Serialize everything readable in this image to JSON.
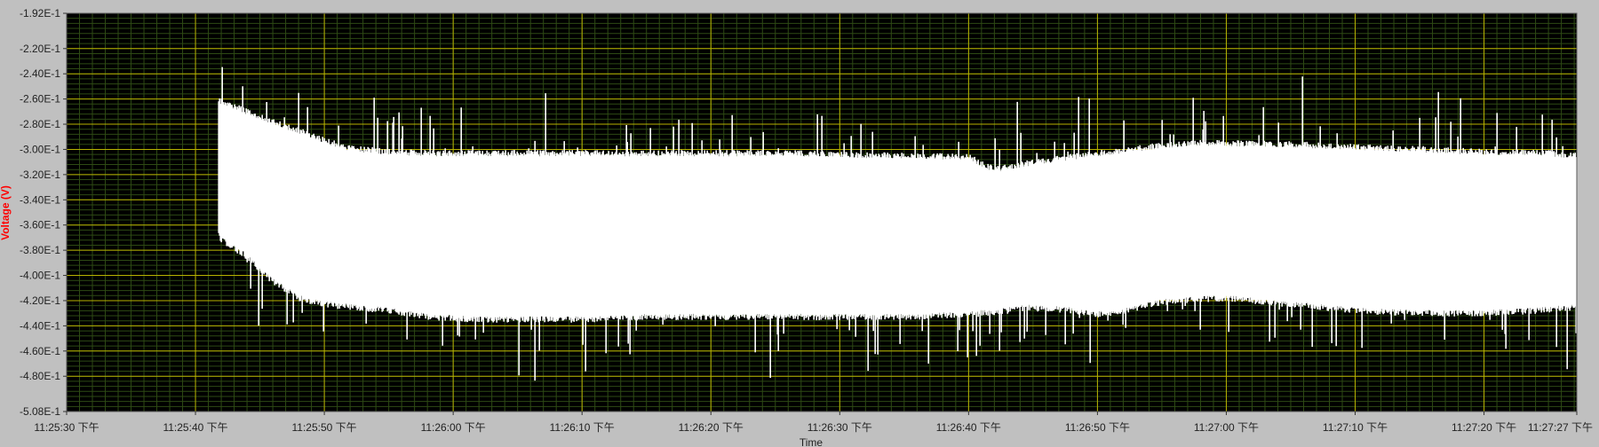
{
  "chart_data": {
    "type": "area",
    "xlabel": "Time",
    "ylabel": "Voltage (V)",
    "x_ticks": [
      {
        "t": 0,
        "label": "11:25:30 下午"
      },
      {
        "t": 10,
        "label": "11:25:40 下午"
      },
      {
        "t": 20,
        "label": "11:25:50 下午"
      },
      {
        "t": 30,
        "label": "11:26:00 下午"
      },
      {
        "t": 40,
        "label": "11:26:10 下午"
      },
      {
        "t": 50,
        "label": "11:26:20 下午"
      },
      {
        "t": 60,
        "label": "11:26:30 下午"
      },
      {
        "t": 70,
        "label": "11:26:40 下午"
      },
      {
        "t": 80,
        "label": "11:26:50 下午"
      },
      {
        "t": 90,
        "label": "11:27:00 下午"
      },
      {
        "t": 100,
        "label": "11:27:10 下午"
      },
      {
        "t": 110,
        "label": "11:27:20 下午"
      },
      {
        "t": 117.2,
        "label": "11:27:27 下午"
      }
    ],
    "y_ticks": [
      {
        "v": -0.192,
        "label": "-1.92E-1"
      },
      {
        "v": -0.22,
        "label": "-2.20E-1"
      },
      {
        "v": -0.24,
        "label": "-2.40E-1"
      },
      {
        "v": -0.26,
        "label": "-2.60E-1"
      },
      {
        "v": -0.28,
        "label": "-2.80E-1"
      },
      {
        "v": -0.3,
        "label": "-3.00E-1"
      },
      {
        "v": -0.32,
        "label": "-3.20E-1"
      },
      {
        "v": -0.34,
        "label": "-3.40E-1"
      },
      {
        "v": -0.36,
        "label": "-3.60E-1"
      },
      {
        "v": -0.38,
        "label": "-3.80E-1"
      },
      {
        "v": -0.4,
        "label": "-4.00E-1"
      },
      {
        "v": -0.42,
        "label": "-4.20E-1"
      },
      {
        "v": -0.44,
        "label": "-4.40E-1"
      },
      {
        "v": -0.46,
        "label": "-4.60E-1"
      },
      {
        "v": -0.48,
        "label": "-4.80E-1"
      },
      {
        "v": -0.508,
        "label": "-5.08E-1"
      }
    ],
    "xlim": [
      0,
      117.2
    ],
    "ylim": [
      -0.508,
      -0.192
    ],
    "grid": true,
    "colors": {
      "plot_bg": "#000000",
      "major_grid": "#b8b200",
      "minor_grid": "#2e4a14",
      "trace": "#ffffff",
      "frame": "#c0c0c0",
      "ylabel": "#ff0000"
    },
    "series": [
      {
        "x": [
          11.8,
          12,
          14,
          16,
          18,
          20,
          22,
          25,
          28,
          32,
          36,
          40,
          45,
          50,
          55,
          60,
          65,
          70,
          72,
          75,
          78,
          80,
          82,
          84,
          86,
          88,
          90,
          95,
          100,
          105,
          110,
          114,
          117.2
        ],
        "upper": [
          -0.262,
          -0.262,
          -0.27,
          -0.278,
          -0.285,
          -0.293,
          -0.299,
          -0.302,
          -0.303,
          -0.303,
          -0.303,
          -0.303,
          -0.303,
          -0.303,
          -0.303,
          -0.304,
          -0.305,
          -0.306,
          -0.316,
          -0.31,
          -0.306,
          -0.303,
          -0.301,
          -0.298,
          -0.296,
          -0.295,
          -0.295,
          -0.296,
          -0.298,
          -0.3,
          -0.302,
          -0.302,
          -0.305
        ],
        "lower": [
          -0.368,
          -0.372,
          -0.385,
          -0.405,
          -0.418,
          -0.423,
          -0.425,
          -0.428,
          -0.433,
          -0.435,
          -0.435,
          -0.435,
          -0.433,
          -0.433,
          -0.433,
          -0.433,
          -0.433,
          -0.431,
          -0.429,
          -0.425,
          -0.428,
          -0.431,
          -0.429,
          -0.423,
          -0.42,
          -0.419,
          -0.418,
          -0.423,
          -0.428,
          -0.43,
          -0.43,
          -0.428,
          -0.425
        ]
      }
    ]
  }
}
